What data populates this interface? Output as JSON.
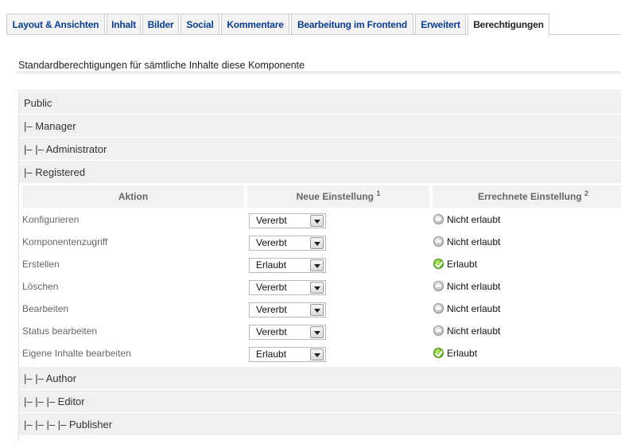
{
  "tabs": [
    {
      "label": "Layout & Ansichten",
      "active": false
    },
    {
      "label": "Inhalt",
      "active": false
    },
    {
      "label": "Bilder",
      "active": false
    },
    {
      "label": "Social",
      "active": false
    },
    {
      "label": "Kommentare",
      "active": false
    },
    {
      "label": "Bearbeitung im Frontend",
      "active": false
    },
    {
      "label": "Erweitert",
      "active": false
    },
    {
      "label": "Berechtigungen",
      "active": true
    }
  ],
  "panel": {
    "title": "Standardberechtigungen für sämtliche Inhalte diese Komponente"
  },
  "groups_top": [
    {
      "label": "Public"
    },
    {
      "label": "|– Manager"
    },
    {
      "label": "|– |– Administrator"
    },
    {
      "label": "|– Registered"
    }
  ],
  "table": {
    "headers": {
      "action": "Aktion",
      "new_setting": "Neue Einstellung",
      "new_setting_note": "1",
      "calculated": "Errechnete Einstellung",
      "calculated_note": "2"
    },
    "rows": [
      {
        "action": "Konfigurieren",
        "setting": "Vererbt",
        "result": "Nicht erlaubt",
        "status": "denied"
      },
      {
        "action": "Komponentenzugriff",
        "setting": "Vererbt",
        "result": "Nicht erlaubt",
        "status": "denied"
      },
      {
        "action": "Erstellen",
        "setting": "Erlaubt",
        "result": "Erlaubt",
        "status": "allowed"
      },
      {
        "action": "Löschen",
        "setting": "Vererbt",
        "result": "Nicht erlaubt",
        "status": "denied"
      },
      {
        "action": "Bearbeiten",
        "setting": "Vererbt",
        "result": "Nicht erlaubt",
        "status": "denied"
      },
      {
        "action": "Status bearbeiten",
        "setting": "Vererbt",
        "result": "Nicht erlaubt",
        "status": "denied"
      },
      {
        "action": "Eigene Inhalte bearbeiten",
        "setting": "Erlaubt",
        "result": "Erlaubt",
        "status": "allowed"
      }
    ]
  },
  "groups_bottom": [
    {
      "label": "|– |– Author"
    },
    {
      "label": "|– |– |– Editor"
    },
    {
      "label": "|– |– |– |– Publisher"
    }
  ],
  "colors": {
    "tab_text": "#0b3c8c",
    "group_bg": "#f0f0f0",
    "allowed": "#4f9c14",
    "denied": "#a9a9a9"
  }
}
